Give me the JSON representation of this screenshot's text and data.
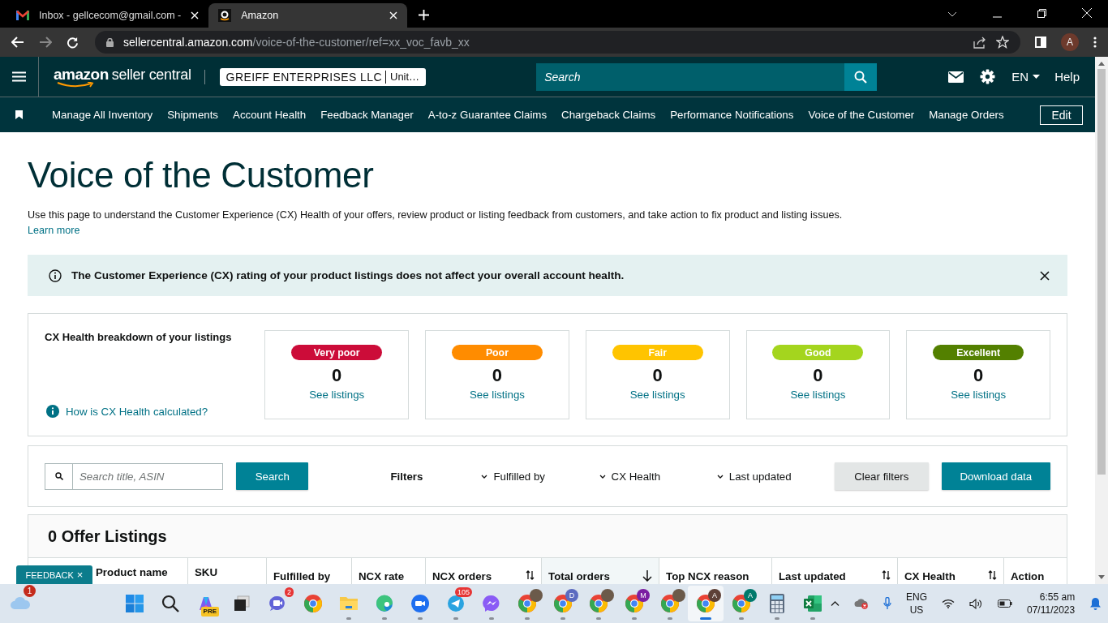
{
  "browser": {
    "tabs": [
      {
        "title": "Inbox - gellcecom@gmail.com -",
        "selected": false
      },
      {
        "title": "Amazon",
        "selected": true
      }
    ],
    "url": {
      "host": "sellercentral.amazon.com",
      "path": "/voice-of-the-customer/ref=xx_voc_favb_xx"
    },
    "profile": "A"
  },
  "header": {
    "brand": "amazon",
    "product": "seller central",
    "store": "GREIFF ENTERPRISES LLC",
    "marketplace": "Unit…",
    "search": {
      "placeholder": "Search"
    },
    "language": "EN",
    "help": "Help"
  },
  "nav": {
    "items": [
      "Manage All Inventory",
      "Shipments",
      "Account Health",
      "Feedback Manager",
      "A-to-z Guarantee Claims",
      "Chargeback Claims",
      "Performance Notifications",
      "Voice of the Customer",
      "Manage Orders"
    ],
    "edit": "Edit"
  },
  "page": {
    "title": "Voice of the Customer",
    "description": "Use this page to understand the Customer Experience (CX) Health of your offers, review product or listing feedback from customers, and take action to fix product and listing issues.",
    "learn_more": "Learn more"
  },
  "alert": {
    "text": "The Customer Experience (CX) rating of your product listings does not affect your overall account health."
  },
  "breakdown": {
    "title": "CX Health breakdown of your listings",
    "help_link": "How is CX Health calculated?",
    "tiles": [
      {
        "label": "Very poor",
        "color": "#cc0c39",
        "count": "0",
        "link": "See listings"
      },
      {
        "label": "Poor",
        "color": "#ff8c00",
        "count": "0",
        "link": "See listings"
      },
      {
        "label": "Fair",
        "color": "#ffc400",
        "count": "0",
        "link": "See listings"
      },
      {
        "label": "Good",
        "color": "#a4d51e",
        "count": "0",
        "link": "See listings"
      },
      {
        "label": "Excellent",
        "color": "#538000",
        "count": "0",
        "link": "See listings"
      }
    ]
  },
  "filters": {
    "search": {
      "placeholder": "Search title, ASIN"
    },
    "search_button": "Search",
    "label": "Filters",
    "dropdowns": [
      "Fulfilled by",
      "CX Health",
      "Last updated"
    ],
    "clear": "Clear filters",
    "download": "Download data"
  },
  "listings": {
    "title": "0 Offer Listings",
    "columns": [
      {
        "label": "Product name",
        "kind": "plain",
        "selected": false
      },
      {
        "label": "SKU",
        "kind": "plain",
        "selected": false
      },
      {
        "label": "Fulfilled by",
        "kind": "plain",
        "selected": false
      },
      {
        "label": "NCX rate",
        "kind": "plain",
        "selected": false
      },
      {
        "label": "NCX orders",
        "kind": "sortable",
        "selected": false
      },
      {
        "label": "Total orders",
        "kind": "sorted",
        "selected": true
      },
      {
        "label": "Top NCX reason",
        "kind": "plain",
        "selected": false
      },
      {
        "label": "Last updated",
        "kind": "sortable",
        "selected": false
      },
      {
        "label": "CX Health",
        "kind": "sortable",
        "selected": false
      },
      {
        "label": "Action",
        "kind": "plain",
        "selected": false
      }
    ]
  },
  "feedback_tab": {
    "label": "FEEDBACK",
    "close": "×"
  },
  "taskbar": {
    "weather_badge": "1",
    "apps": [
      {
        "kind": "start",
        "running": false,
        "selected": false
      },
      {
        "kind": "search",
        "running": false,
        "selected": false
      },
      {
        "kind": "copilot",
        "badge": "PRE",
        "running": false,
        "selected": false
      },
      {
        "kind": "taskview",
        "running": false,
        "selected": false
      },
      {
        "kind": "teams",
        "badge": "2",
        "running": false,
        "selected": false
      },
      {
        "kind": "chrome",
        "running": false,
        "selected": false
      },
      {
        "kind": "files",
        "running": true,
        "selected": false
      },
      {
        "kind": "edge",
        "running": true,
        "selected": false
      },
      {
        "kind": "zoom",
        "running": true,
        "selected": false
      },
      {
        "kind": "telegram",
        "badge": "105",
        "running": true,
        "selected": false
      },
      {
        "kind": "messenger",
        "running": true,
        "selected": false
      },
      {
        "kind": "chrome",
        "photo": true,
        "running": true,
        "selected": false
      },
      {
        "kind": "chrome",
        "avatar": "D",
        "color": "#5c6bc0",
        "running": true,
        "selected": false
      },
      {
        "kind": "chrome",
        "photo": true,
        "running": true,
        "selected": false
      },
      {
        "kind": "chrome",
        "avatar": "M",
        "color": "#7b1fa2",
        "running": true,
        "selected": false
      },
      {
        "kind": "chrome",
        "photo": true,
        "running": true,
        "selected": false
      },
      {
        "kind": "chrome",
        "avatar": "A",
        "color": "#5d4037",
        "running": true,
        "selected": true
      },
      {
        "kind": "chrome",
        "avatar": "A",
        "color": "#00796b",
        "running": true,
        "selected": false
      },
      {
        "kind": "calculator",
        "running": true,
        "selected": false
      },
      {
        "kind": "excel",
        "running": true,
        "selected": false
      }
    ],
    "language": "ENG",
    "region": "US",
    "time": "6:55 am",
    "date": "07/11/2023"
  }
}
